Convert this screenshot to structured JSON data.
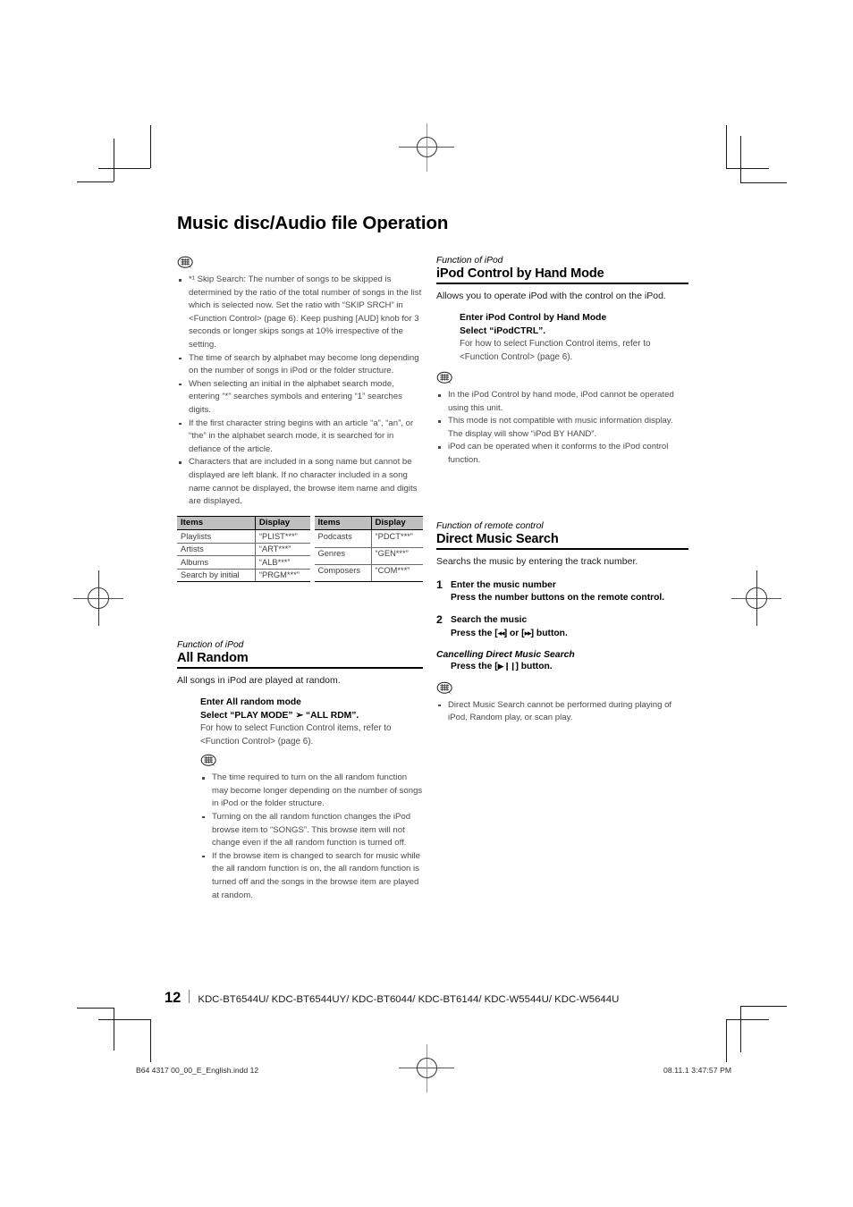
{
  "page": {
    "chapter_title": "Music disc/Audio file Operation",
    "folio_number": "12",
    "models": "KDC-BT6544U/ KDC-BT6544UY/ KDC-BT6044/ KDC-BT6144/ KDC-W5544U/ KDC-W5644U",
    "print_footer_left": "B64 4317 00_00_E_English.indd   12",
    "print_footer_right": "08.11.1   3:47:57 PM"
  },
  "left_column": {
    "top_notes": {
      "icon": "note-bubble-icon",
      "items": [
        "*¹ Skip Search: The number of songs to be skipped is determined by the ratio of the total number of songs in the list which is selected now. Set the ratio with “SKIP SRCH” in <Function Control> (page 6). Keep pushing [AUD] knob for 3 seconds or longer skips songs at 10% irrespective of the setting.",
        "The time of search by alphabet may become long depending on the number of songs in iPod or the folder structure.",
        "When selecting an initial in the alphabet search mode, entering “*” searches symbols and entering “1” searches digits.",
        "If the first character string begins with an article “a”, “an”, or “the” in the alphabet search mode, it is searched for in defiance of the article.",
        "Characters that are included in a song name but cannot be displayed are left blank. If no character included in a song name cannot be displayed, the browse item name and digits are displayed."
      ]
    },
    "table_left": {
      "headers": [
        "Items",
        "Display"
      ],
      "rows": [
        [
          "Playlists",
          "“PLIST***”"
        ],
        [
          "Artists",
          "“ART***”"
        ],
        [
          "Albums",
          "“ALB***”"
        ],
        [
          "Search by initial",
          "“PRGM***”"
        ]
      ]
    },
    "table_right": {
      "headers": [
        "Items",
        "Display"
      ],
      "rows": [
        [
          "Podcasts",
          "“PDCT***”"
        ],
        [
          "Genres",
          "“GEN***”"
        ],
        [
          "Composers",
          "“COM***”"
        ]
      ]
    },
    "all_random": {
      "eyebrow": "Function of iPod",
      "title": "All Random",
      "lead": "All songs in iPod are played at random.",
      "enter_title": "Enter All random mode",
      "enter_select": "Select “PLAY MODE”  ➢ “ALL RDM”.",
      "enter_desc": "For how to select Function Control items, refer to <Function Control> (page 6).",
      "notes_icon": "note-bubble-icon",
      "notes": [
        "The time required to turn on the all random function may become longer depending on the number of songs in iPod or the folder structure.",
        "Turning on the all random function changes the iPod browse item to “SONGS”. This browse item will not change even if the all random function is turned off.",
        "If the browse item is changed to search for music while the all random function is on,  the all random function is turned off and the songs in the browse item are played at random."
      ]
    }
  },
  "right_column": {
    "ipod_control": {
      "eyebrow": "Function of iPod",
      "title": "iPod Control by Hand Mode",
      "lead": "Allows you to operate iPod with the control on the iPod.",
      "enter_title": "Enter iPod Control by Hand Mode",
      "enter_select": "Select “iPodCTRL”.",
      "enter_desc": "For how to select Function Control items, refer to <Function Control> (page 6).",
      "notes_icon": "note-bubble-icon",
      "notes": [
        "In the iPod Control by hand mode, iPod cannot be operated using this unit.",
        "This mode is not compatible with music information display. The display will show “iPod BY HAND”.",
        "iPod can be operated when it conforms to the iPod control function."
      ]
    },
    "direct_music_search": {
      "eyebrow": "Function of remote control",
      "title": "Direct Music Search",
      "lead": "Searchs the music by entering the track number.",
      "steps": [
        {
          "num": "1",
          "title": "Enter the music number",
          "body": "Press the number buttons on the remote control."
        },
        {
          "num": "2",
          "title": "Search the music",
          "body_prefix": "Press the [",
          "body_btn1": "◂◂",
          "body_mid": "] or [",
          "body_btn2": "▸▸",
          "body_suffix": "] button."
        }
      ],
      "cancel_head": "Cancelling Direct Music Search",
      "cancel_prefix": "Press the [",
      "cancel_btn": "▶ ❙❙",
      "cancel_suffix": "] button.",
      "notes_icon": "note-bubble-icon",
      "notes": [
        "Direct Music Search cannot be performed during playing of iPod, Random play, or scan play."
      ]
    }
  }
}
